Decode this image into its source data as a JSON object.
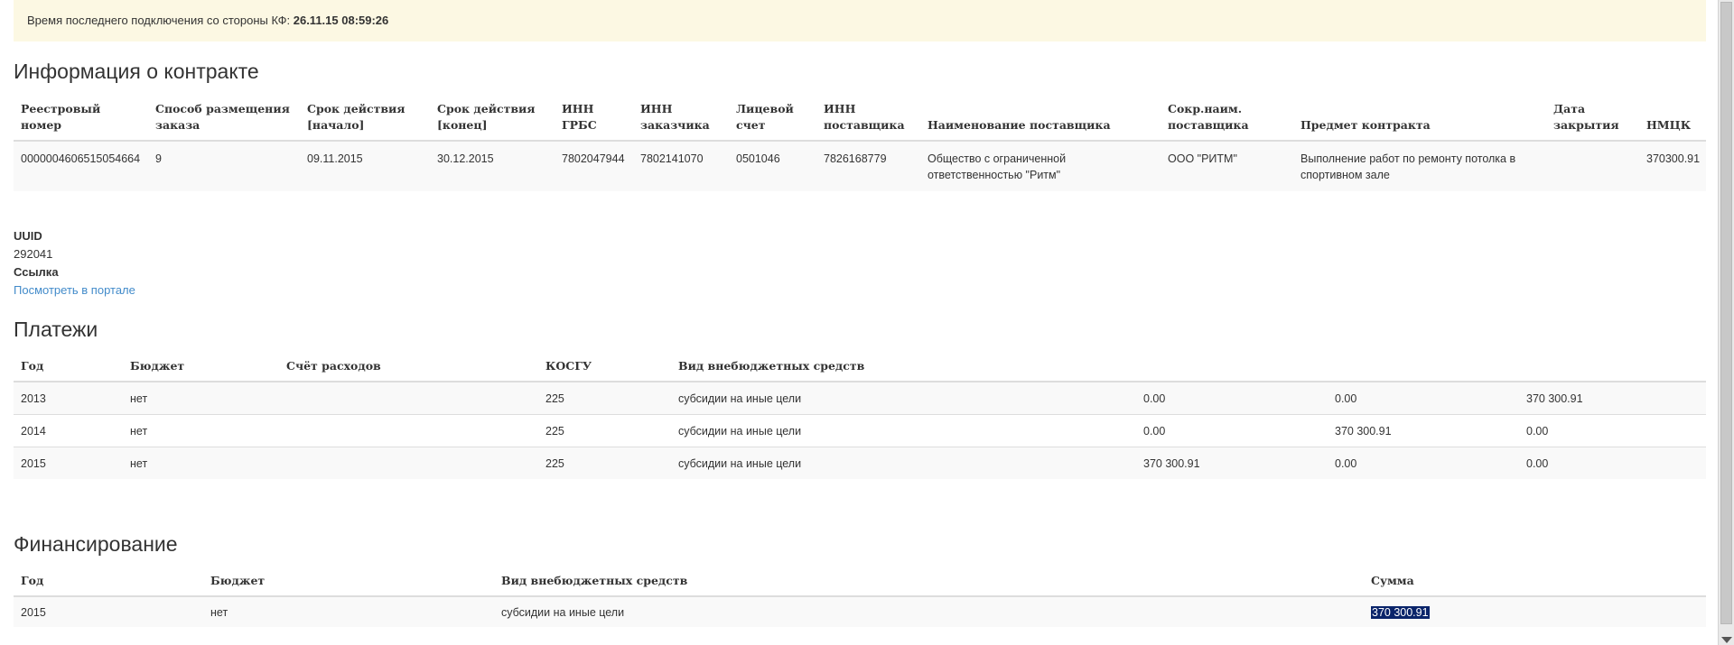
{
  "alert": {
    "label": "Время последнего подключения со стороны КФ:",
    "value": "26.11.15 08:59:26"
  },
  "contract": {
    "title": "Информация о контракте",
    "headers": [
      "Реестровый номер",
      "Способ размещения заказа",
      "Срок действия [начало]",
      "Срок действия [конец]",
      "ИНН ГРБС",
      "ИНН заказчика",
      "Лицевой счет",
      "ИНН поставщика",
      "Наименование поставщика",
      "Сокр.наим. поставщика",
      "Предмет контракта",
      "Дата закрытия",
      "НМЦК"
    ],
    "rows": [
      [
        "0000004606515054664",
        "9",
        "09.11.2015",
        "30.12.2015",
        "7802047944",
        "7802141070",
        "0501046",
        "7826168779",
        "Общество с ограниченной ответственностью \"Ритм\"",
        "ООО \"РИТМ\"",
        "Выполнение работ по ремонту потолка в спортивном зале",
        "",
        "370300.91"
      ]
    ]
  },
  "meta": {
    "uuid_label": "UUID",
    "uuid_value": "292041",
    "link_label": "Ссылка",
    "link_text": "Посмотреть в портале"
  },
  "payments": {
    "title": "Платежи",
    "headers": [
      "Год",
      "Бюджет",
      "Счёт расходов",
      "КОСГУ",
      "Вид внебюджетных средств",
      "",
      "",
      ""
    ],
    "rows": [
      [
        "2013",
        "нет",
        "",
        "225",
        "субсидии на иные цели",
        "0.00",
        "0.00",
        "370 300.91"
      ],
      [
        "2014",
        "нет",
        "",
        "225",
        "субсидии на иные цели",
        "0.00",
        "370 300.91",
        "0.00"
      ],
      [
        "2015",
        "нет",
        "",
        "225",
        "субсидии на иные цели",
        "370 300.91",
        "0.00",
        "0.00"
      ]
    ]
  },
  "financing": {
    "title": "Финансирование",
    "headers": [
      "Год",
      "Бюджет",
      "Вид внебюджетных средств",
      "Сумма"
    ],
    "rows": [
      [
        "2015",
        "нет",
        "субсидии на иные цели",
        "370 300.91"
      ]
    ]
  }
}
